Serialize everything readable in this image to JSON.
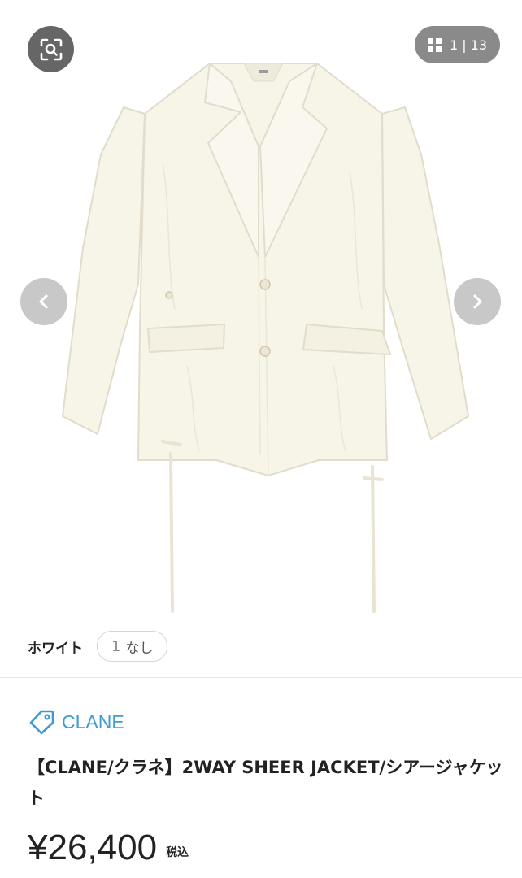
{
  "gallery": {
    "image_alt": "【CLANE/クラネ】2WAY SHEER JACKET/シアージャケット",
    "counter_current": "1",
    "counter_separator": "|",
    "counter_total": "13",
    "icons": {
      "lens": "image-search-icon",
      "grid": "grid-icon",
      "prev": "chevron-left-icon",
      "next": "chevron-right-icon"
    }
  },
  "variant": {
    "label": "ホワイト",
    "option_number": "1",
    "option_text": "なし"
  },
  "product": {
    "brand": "CLANE",
    "title": "【CLANE/クラネ】2WAY SHEER JACKET/シアージャケット",
    "price": "¥26,400",
    "tax_label": "税込"
  },
  "colors": {
    "brand_accent": "#3d9bd1",
    "jacket": "#f7f4e8"
  }
}
